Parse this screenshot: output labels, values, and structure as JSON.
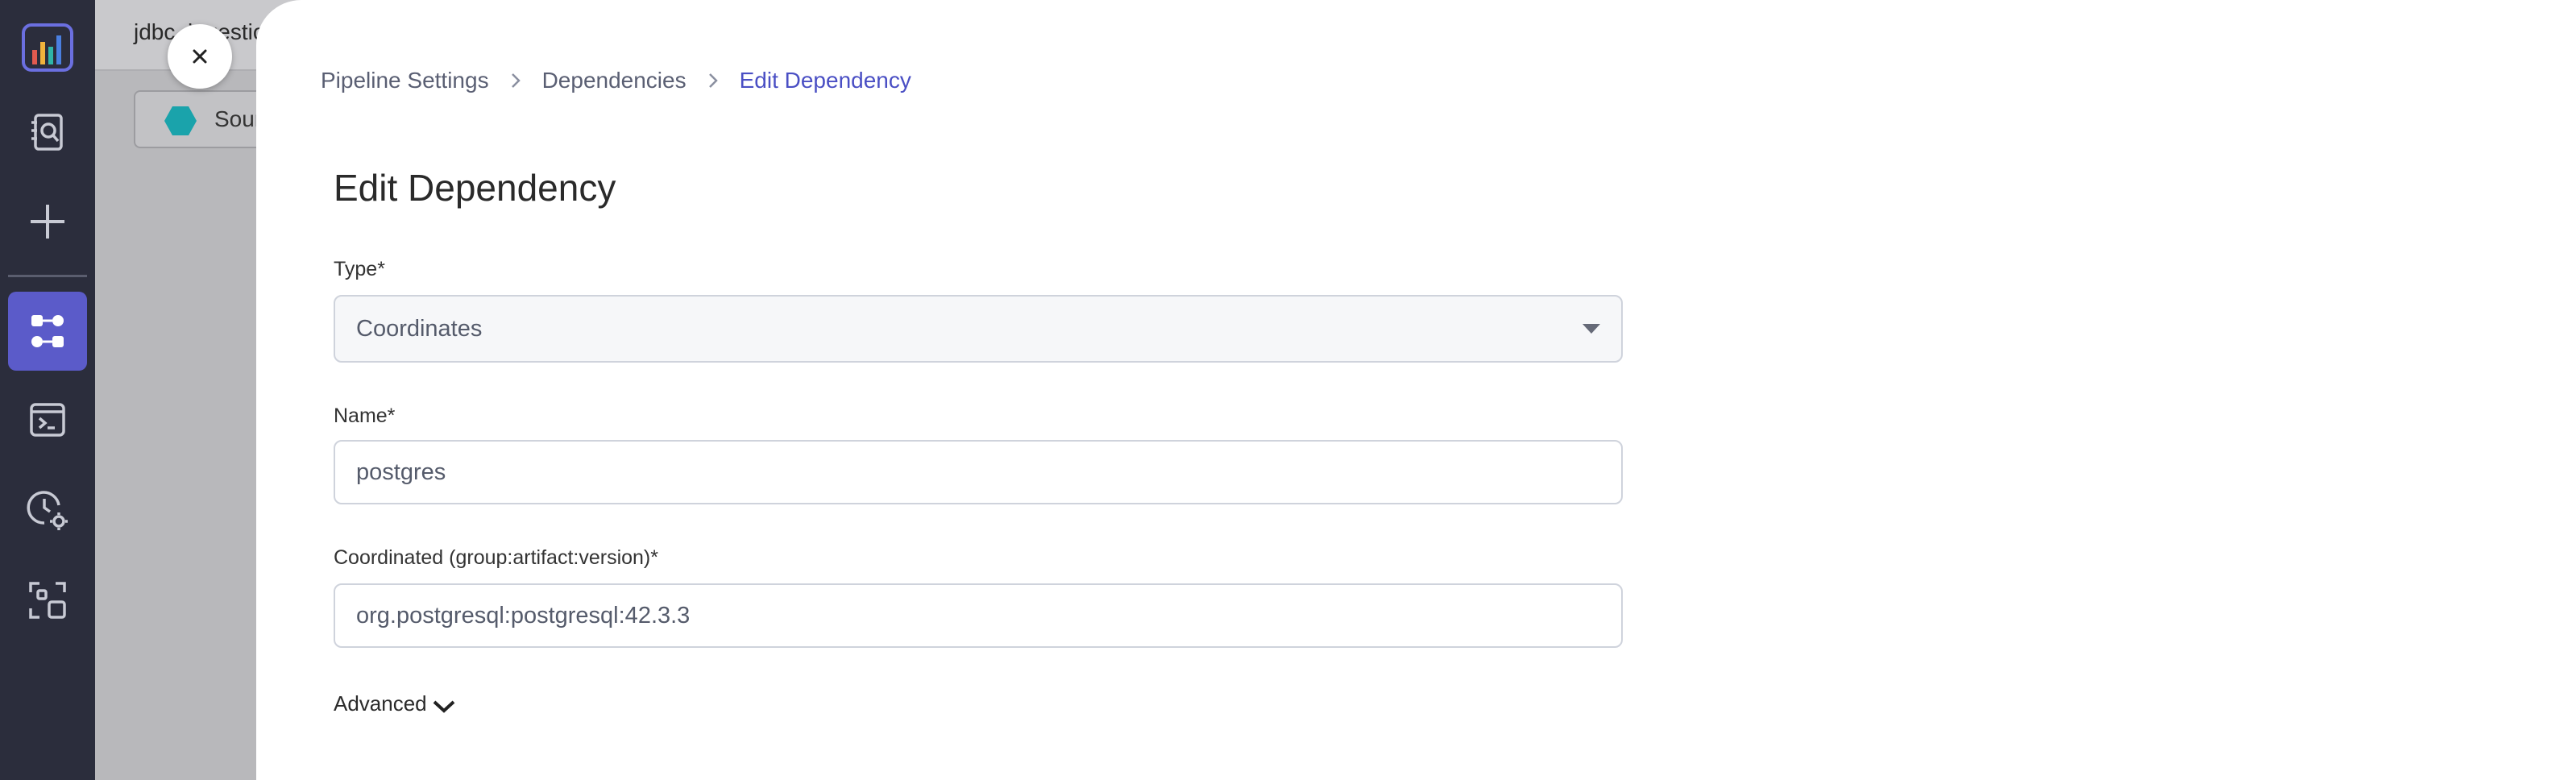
{
  "sidebar": {
    "items": [
      {
        "icon": "logo-chart-icon",
        "active": false
      },
      {
        "icon": "search-document-icon",
        "active": false
      },
      {
        "icon": "plus-icon",
        "active": false
      },
      {
        "icon": "pipeline-nodes-icon",
        "active": true
      },
      {
        "icon": "terminal-icon",
        "active": false
      },
      {
        "icon": "clock-settings-icon",
        "active": false
      },
      {
        "icon": "scan-frame-icon",
        "active": false
      }
    ]
  },
  "background": {
    "project_name": "jdbc_ingestion",
    "chip_label": "Source"
  },
  "breadcrumb": [
    "Pipeline Settings",
    "Dependencies",
    "Edit Dependency"
  ],
  "form": {
    "title": "Edit Dependency",
    "type_label": "Type*",
    "type_value": "Coordinates",
    "name_label": "Name*",
    "name_value": "postgres",
    "coordinates_label": "Coordinated (group:artifact:version)*",
    "coordinates_value": "org.postgresql:postgresql:42.3.3",
    "advanced_label": "Advanced"
  },
  "colors": {
    "rail_bg": "#2b2d3c",
    "accent": "#5b5bc9",
    "breadcrumb_current": "#4a4fc4"
  }
}
